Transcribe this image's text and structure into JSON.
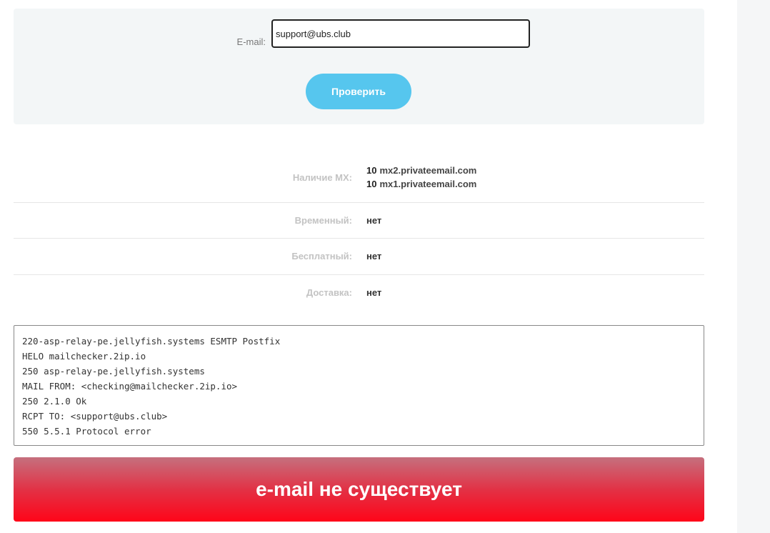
{
  "form": {
    "email_label": "E-mail:",
    "email_value": "support@ubs.club",
    "check_button_label": "Проверить"
  },
  "results": {
    "mx": {
      "label": "Наличие MX:",
      "records": [
        {
          "priority": "10",
          "host": "mx2.privateemail.com"
        },
        {
          "priority": "10",
          "host": "mx1.privateemail.com"
        }
      ]
    },
    "temporary": {
      "label": "Временный:",
      "value": "нет"
    },
    "free": {
      "label": "Бесплатный:",
      "value": "нет"
    },
    "delivery": {
      "label": "Доставка:",
      "value": "нет"
    }
  },
  "log": {
    "lines": [
      "220-asp-relay-pe.jellyfish.systems ESMTP Postfix",
      "HELO mailchecker.2ip.io",
      "250 asp-relay-pe.jellyfish.systems",
      "MAIL FROM: <checking@mailchecker.2ip.io>",
      "250 2.1.0 Ok",
      "RCPT TO: <support@ubs.club>",
      "550 5.5.1 Protocol error"
    ]
  },
  "verdict": {
    "text": "e-mail не существует"
  },
  "colors": {
    "accent_button": "#56c6ee",
    "error_banner_top": "#c5707e",
    "error_banner_bottom": "#ff0519"
  }
}
